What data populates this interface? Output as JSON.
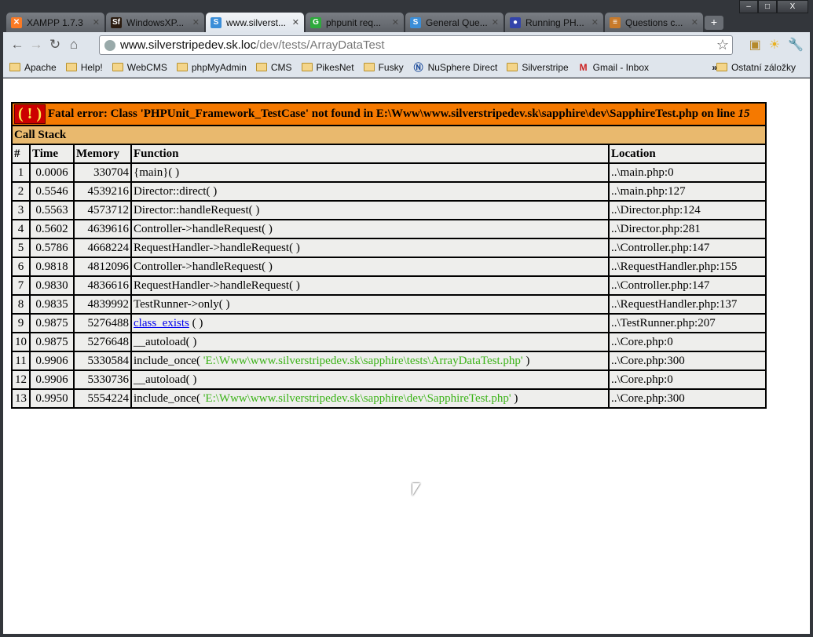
{
  "window": {
    "buttons": [
      "–",
      "□",
      "X"
    ]
  },
  "tabs": [
    {
      "label": "XAMPP 1.7.3",
      "icon": "xampp-icon",
      "color": "#fb7a24",
      "glyph": "✕"
    },
    {
      "label": "WindowsXP...",
      "icon": "symfony-icon",
      "color": "#2b1c10",
      "glyph": "Sf"
    },
    {
      "label": "www.silverst...",
      "icon": "silverstripe-icon",
      "color": "#3b8ed8",
      "glyph": "S",
      "active": true
    },
    {
      "label": "phpunit req...",
      "icon": "g-icon",
      "color": "#2eaa3c",
      "glyph": "G"
    },
    {
      "label": "General Que...",
      "icon": "silverstripe-icon",
      "color": "#3b8ed8",
      "glyph": "S"
    },
    {
      "label": "Running PH...",
      "icon": "php-icon",
      "color": "#3344aa",
      "glyph": "●"
    },
    {
      "label": "Questions c...",
      "icon": "stackoverflow-icon",
      "color": "#c87a2a",
      "glyph": "≡"
    }
  ],
  "toolbar": {
    "url_host": "www.silverstripedev.sk.loc",
    "url_path": "/dev/tests/ArrayDataTest"
  },
  "bookmarks": [
    {
      "label": "Apache",
      "type": "folder"
    },
    {
      "label": "Help!",
      "type": "folder"
    },
    {
      "label": "WebCMS",
      "type": "folder"
    },
    {
      "label": "phpMyAdmin",
      "type": "folder"
    },
    {
      "label": "CMS",
      "type": "folder"
    },
    {
      "label": "PikesNet",
      "type": "folder"
    },
    {
      "label": "Fusky",
      "type": "folder"
    },
    {
      "label": "NuSphere Direct",
      "type": "link"
    },
    {
      "label": "Silverstripe",
      "type": "folder"
    },
    {
      "label": "Gmail - Inbox",
      "type": "gmail"
    }
  ],
  "bookmarks_more": "»",
  "other_bookmarks": "Ostatní záložky",
  "error": {
    "icon": "( ! )",
    "prefix": "Fatal error: Class 'PHPUnit_Framework_TestCase' not found in E:\\Www\\www.silverstripedev.sk\\sapphire\\dev\\SapphireTest.php on line ",
    "line": "15"
  },
  "call_stack_title": "Call Stack",
  "columns": [
    "#",
    "Time",
    "Memory",
    "Function",
    "Location"
  ],
  "rows": [
    {
      "n": "1",
      "time": "0.0006",
      "mem": "330704",
      "fn": "{main}( )",
      "loc": "..\\main.php:0"
    },
    {
      "n": "2",
      "time": "0.5546",
      "mem": "4539216",
      "fn": "Director::direct( )",
      "loc": "..\\main.php:127"
    },
    {
      "n": "3",
      "time": "0.5563",
      "mem": "4573712",
      "fn": "Director::handleRequest( )",
      "loc": "..\\Director.php:124"
    },
    {
      "n": "4",
      "time": "0.5602",
      "mem": "4639616",
      "fn": "Controller->handleRequest( )",
      "loc": "..\\Director.php:281"
    },
    {
      "n": "5",
      "time": "0.5786",
      "mem": "4668224",
      "fn": "RequestHandler->handleRequest( )",
      "loc": "..\\Controller.php:147"
    },
    {
      "n": "6",
      "time": "0.9818",
      "mem": "4812096",
      "fn": "Controller->handleRequest( )",
      "loc": "..\\RequestHandler.php:155"
    },
    {
      "n": "7",
      "time": "0.9830",
      "mem": "4836616",
      "fn": "RequestHandler->handleRequest( )",
      "loc": "..\\Controller.php:147"
    },
    {
      "n": "8",
      "time": "0.9835",
      "mem": "4839992",
      "fn": "TestRunner->only( )",
      "loc": "..\\RequestHandler.php:137"
    },
    {
      "n": "9",
      "time": "0.9875",
      "mem": "5276488",
      "fn_link": "class_exists",
      "fn": " ( )",
      "loc": "..\\TestRunner.php:207"
    },
    {
      "n": "10",
      "time": "0.9875",
      "mem": "5276648",
      "fn": "__autoload( )",
      "loc": "..\\Core.php:0"
    },
    {
      "n": "11",
      "time": "0.9906",
      "mem": "5330584",
      "fn": "include_once( ",
      "fn_str": "'E:\\Www\\www.silverstripedev.sk\\sapphire\\tests\\ArrayDataTest.php'",
      "fn_end": " )",
      "loc": "..\\Core.php:300"
    },
    {
      "n": "12",
      "time": "0.9906",
      "mem": "5330736",
      "fn": "__autoload( )",
      "loc": "..\\Core.php:0"
    },
    {
      "n": "13",
      "time": "0.9950",
      "mem": "5554224",
      "fn": "include_once( ",
      "fn_str": "'E:\\Www\\www.silverstripedev.sk\\sapphire\\dev\\SapphireTest.php'",
      "fn_end": " )",
      "loc": "..\\Core.php:300"
    }
  ],
  "colors": {
    "error_bg": "#f57900",
    "callstack_bg": "#e9b96e",
    "row_bg": "#eeeeec",
    "string": "#3bb318"
  }
}
